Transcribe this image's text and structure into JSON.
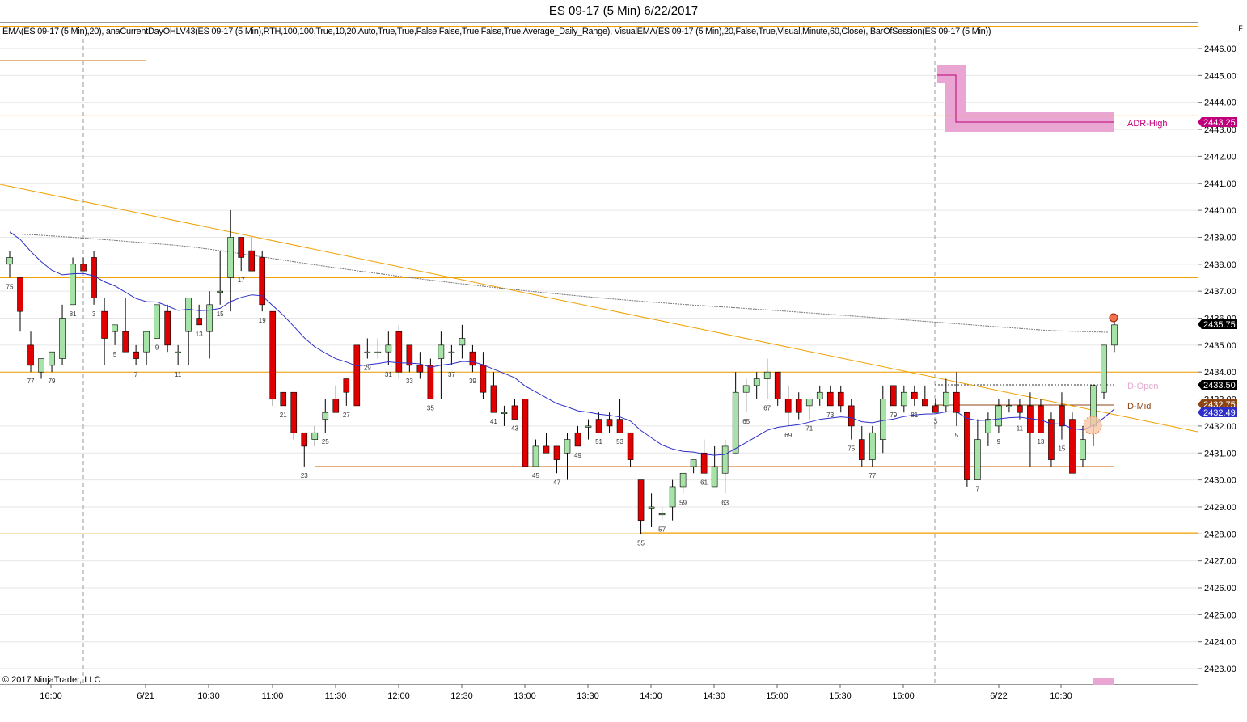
{
  "window": {
    "title": "ES 09-17 (5 Min)  6/22/2017",
    "indicator_text": "EMA(ES 09-17 (5 Min),20), anaCurrentDayOHLV43(ES 09-17 (5 Min),RTH,100,100,True,10,20,Auto,True,True,False,False,True,False,True,Average_Daily_Range), VisualEMA(ES 09-17 (5 Min),20,False,True,Visual,Minute,60,Close), BarOfSession(ES 09-17 (5 Min))",
    "copyright": "© 2017 NinjaTrader, LLC",
    "corner_button": "F"
  },
  "colors": {
    "up": "#a6e3a6",
    "down": "#e00000",
    "ema": "#2d2dc8",
    "level": "#f0a000",
    "adr": "#c0007a",
    "adr_zone": "#e9a6d3",
    "dmid": "#8b4513"
  },
  "price_axis": {
    "ticks": [
      "2446.00",
      "2445.00",
      "2444.00",
      "2443.00",
      "2442.00",
      "2441.00",
      "2440.00",
      "2439.00",
      "2438.00",
      "2437.00",
      "2436.00",
      "2435.00",
      "2434.00",
      "2433.00",
      "2432.00",
      "2431.00",
      "2430.00",
      "2429.00",
      "2428.00",
      "2427.00",
      "2426.00",
      "2425.00",
      "2424.00",
      "2423.00"
    ],
    "tags": {
      "adr_high": "2443.25",
      "last": "2435.75",
      "d_open": "2433.50",
      "d_mid": "2432.75",
      "ema": "2432.49"
    }
  },
  "time_axis": {
    "labels": [
      "16:00",
      "6/21",
      "10:30",
      "11:00",
      "11:30",
      "12:00",
      "12:30",
      "13:00",
      "13:30",
      "14:00",
      "14:30",
      "15:00",
      "15:30",
      "16:00",
      "6/22",
      "10:30"
    ]
  },
  "labels": {
    "adr_high": "ADR-High",
    "d_open": "D-Open",
    "d_mid": "D-Mid"
  },
  "bar_numbers": [
    "75",
    "77",
    "79",
    "81",
    "3",
    "5",
    "7",
    "9",
    "11",
    "13",
    "15",
    "17",
    "19",
    "21",
    "23",
    "25",
    "27",
    "29",
    "31",
    "33",
    "35",
    "37",
    "39",
    "41",
    "43",
    "45",
    "47",
    "49",
    "51",
    "53",
    "55",
    "57",
    "59",
    "61",
    "63",
    "65",
    "67",
    "69",
    "71",
    "73",
    "75",
    "77",
    "79",
    "81",
    "3",
    "5",
    "7",
    "9",
    "11",
    "13",
    "15"
  ],
  "chart_data": {
    "type": "candlestick",
    "symbol": "ES 09-17 (5 Min)",
    "ylim": [
      2422.5,
      2447.0
    ],
    "levels": [
      2446.6,
      2443.5,
      2437.5,
      2434.0,
      2430.5,
      2428.0
    ],
    "candles": [
      [
        2438.0,
        2438.5,
        2437.5,
        2438.25
      ],
      [
        2437.5,
        2437.5,
        2435.5,
        2436.25
      ],
      [
        2435.0,
        2435.5,
        2434.0,
        2434.25
      ],
      [
        2434.0,
        2434.5,
        2433.75,
        2434.5
      ],
      [
        2434.25,
        2434.5,
        2434.0,
        2434.75
      ],
      [
        2434.5,
        2436.5,
        2434.25,
        2436.0
      ],
      [
        2436.5,
        2438.25,
        2436.5,
        2438.0
      ],
      [
        2438.0,
        2438.25,
        2437.75,
        2437.75
      ],
      [
        2438.25,
        2438.5,
        2436.5,
        2436.75
      ],
      [
        2436.25,
        2436.75,
        2434.25,
        2435.25
      ],
      [
        2435.5,
        2435.75,
        2435.0,
        2435.75
      ],
      [
        2435.5,
        2436.75,
        2434.75,
        2434.75
      ],
      [
        2434.75,
        2435.0,
        2434.25,
        2434.5
      ],
      [
        2434.75,
        2435.5,
        2434.25,
        2435.5
      ],
      [
        2435.25,
        2436.25,
        2435.25,
        2436.5
      ],
      [
        2436.25,
        2436.5,
        2434.75,
        2435.0
      ],
      [
        2434.75,
        2435.0,
        2434.25,
        2434.75
      ],
      [
        2435.5,
        2436.5,
        2434.25,
        2436.75
      ],
      [
        2436.0,
        2436.5,
        2435.75,
        2435.75
      ],
      [
        2435.5,
        2437.0,
        2434.5,
        2436.5
      ],
      [
        2437.0,
        2438.5,
        2436.5,
        2437.0
      ],
      [
        2437.5,
        2440.0,
        2436.25,
        2439.0
      ],
      [
        2439.0,
        2439.0,
        2437.75,
        2438.25
      ],
      [
        2438.5,
        2439.0,
        2437.75,
        2437.75
      ],
      [
        2438.25,
        2438.5,
        2436.25,
        2436.5
      ],
      [
        2436.25,
        2436.25,
        2432.75,
        2433.0
      ],
      [
        2433.25,
        2433.25,
        2432.75,
        2432.75
      ],
      [
        2433.25,
        2433.25,
        2431.5,
        2431.75
      ],
      [
        2431.75,
        2431.25,
        2430.5,
        2431.25
      ],
      [
        2431.5,
        2432.0,
        2431.25,
        2431.75
      ],
      [
        2432.25,
        2433.0,
        2431.75,
        2432.5
      ],
      [
        2433.0,
        2433.5,
        2432.75,
        2432.5
      ],
      [
        2433.75,
        2433.75,
        2432.75,
        2433.25
      ],
      [
        2435.0,
        2435.0,
        2432.75,
        2432.75
      ],
      [
        2434.75,
        2435.25,
        2434.5,
        2434.75
      ],
      [
        2434.75,
        2435.25,
        2434.5,
        2434.75
      ],
      [
        2434.75,
        2435.5,
        2434.25,
        2435.0
      ],
      [
        2435.5,
        2435.75,
        2433.75,
        2434.0
      ],
      [
        2435.0,
        2435.0,
        2434.0,
        2434.25
      ],
      [
        2434.25,
        2434.75,
        2433.75,
        2434.0
      ],
      [
        2434.25,
        2434.5,
        2433.0,
        2433.0
      ],
      [
        2434.5,
        2435.5,
        2433.0,
        2435.0
      ],
      [
        2434.75,
        2435.0,
        2434.25,
        2434.75
      ],
      [
        2435.0,
        2435.75,
        2434.5,
        2435.25
      ],
      [
        2434.75,
        2435.0,
        2434.0,
        2434.25
      ],
      [
        2434.25,
        2434.75,
        2433.0,
        2433.25
      ],
      [
        2433.5,
        2434.0,
        2432.5,
        2432.5
      ],
      [
        2432.5,
        2432.75,
        2432.0,
        2432.5
      ],
      [
        2432.75,
        2433.0,
        2432.25,
        2432.25
      ],
      [
        2433.0,
        2433.0,
        2430.5,
        2430.5
      ],
      [
        2430.5,
        2431.5,
        2430.5,
        2431.25
      ],
      [
        2431.25,
        2431.75,
        2431.0,
        2431.0
      ],
      [
        2431.25,
        2431.25,
        2430.25,
        2430.75
      ],
      [
        2431.0,
        2431.75,
        2430.0,
        2431.5
      ],
      [
        2431.75,
        2432.0,
        2431.25,
        2431.25
      ],
      [
        2432.0,
        2432.25,
        2431.5,
        2432.0
      ],
      [
        2432.25,
        2432.5,
        2431.75,
        2431.75
      ],
      [
        2432.25,
        2432.5,
        2431.75,
        2432.0
      ],
      [
        2432.25,
        2433.0,
        2431.75,
        2431.75
      ],
      [
        2431.75,
        2431.75,
        2430.5,
        2430.75
      ],
      [
        2430.0,
        2430.0,
        2428.0,
        2428.5
      ],
      [
        2429.0,
        2429.5,
        2428.25,
        2429.0
      ],
      [
        2428.75,
        2429.0,
        2428.5,
        2428.75
      ],
      [
        2429.0,
        2430.0,
        2428.5,
        2429.75
      ],
      [
        2429.75,
        2430.25,
        2429.5,
        2430.25
      ],
      [
        2430.5,
        2430.75,
        2430.25,
        2430.75
      ],
      [
        2431.0,
        2431.5,
        2430.25,
        2430.25
      ],
      [
        2429.75,
        2431.25,
        2429.75,
        2430.5
      ],
      [
        2430.25,
        2431.5,
        2429.5,
        2431.25
      ],
      [
        2431.0,
        2434.0,
        2431.0,
        2433.25
      ],
      [
        2433.25,
        2433.75,
        2432.5,
        2433.5
      ],
      [
        2433.5,
        2434.0,
        2433.0,
        2433.75
      ],
      [
        2433.75,
        2434.5,
        2433.0,
        2434.0
      ],
      [
        2434.0,
        2434.0,
        2432.75,
        2433.0
      ],
      [
        2433.0,
        2433.5,
        2432.0,
        2432.5
      ],
      [
        2433.0,
        2433.25,
        2432.25,
        2432.5
      ],
      [
        2432.75,
        2433.0,
        2432.25,
        2433.0
      ],
      [
        2433.0,
        2433.5,
        2432.75,
        2433.25
      ],
      [
        2433.25,
        2433.5,
        2432.75,
        2432.75
      ],
      [
        2433.25,
        2433.5,
        2432.5,
        2432.75
      ],
      [
        2432.75,
        2433.0,
        2431.5,
        2432.0
      ],
      [
        2431.5,
        2432.0,
        2430.5,
        2430.75
      ],
      [
        2430.75,
        2432.0,
        2430.5,
        2431.75
      ],
      [
        2431.5,
        2433.5,
        2431.0,
        2433.0
      ],
      [
        2433.5,
        2433.5,
        2432.75,
        2432.75
      ],
      [
        2432.75,
        2433.5,
        2432.5,
        2433.25
      ],
      [
        2433.25,
        2433.5,
        2432.75,
        2433.0
      ],
      [
        2433.0,
        2433.5,
        2432.75,
        2432.75
      ],
      [
        2432.75,
        2433.0,
        2432.5,
        2432.5
      ],
      [
        2432.75,
        2433.75,
        2432.5,
        2433.25
      ],
      [
        2433.25,
        2434.0,
        2432.0,
        2432.5
      ],
      [
        2432.5,
        2432.5,
        2429.75,
        2430.0
      ],
      [
        2430.0,
        2432.25,
        2430.0,
        2431.5
      ],
      [
        2431.75,
        2432.5,
        2431.25,
        2432.25
      ],
      [
        2432.0,
        2433.0,
        2431.75,
        2432.75
      ],
      [
        2432.75,
        2433.0,
        2432.5,
        2432.75
      ],
      [
        2432.75,
        2433.0,
        2432.25,
        2432.5
      ],
      [
        2432.75,
        2433.25,
        2430.5,
        2431.75
      ],
      [
        2432.75,
        2433.0,
        2431.75,
        2431.75
      ],
      [
        2432.25,
        2432.5,
        2430.5,
        2430.75
      ],
      [
        2432.75,
        2433.25,
        2431.5,
        2432.0
      ],
      [
        2432.25,
        2432.5,
        2430.5,
        2430.25
      ],
      [
        2430.75,
        2432.0,
        2430.5,
        2431.5
      ],
      [
        2432.0,
        2433.5,
        2431.25,
        2433.5
      ],
      [
        2433.25,
        2435.0,
        2433.0,
        2435.0
      ],
      [
        2435.0,
        2436.0,
        2434.75,
        2435.75
      ]
    ]
  }
}
